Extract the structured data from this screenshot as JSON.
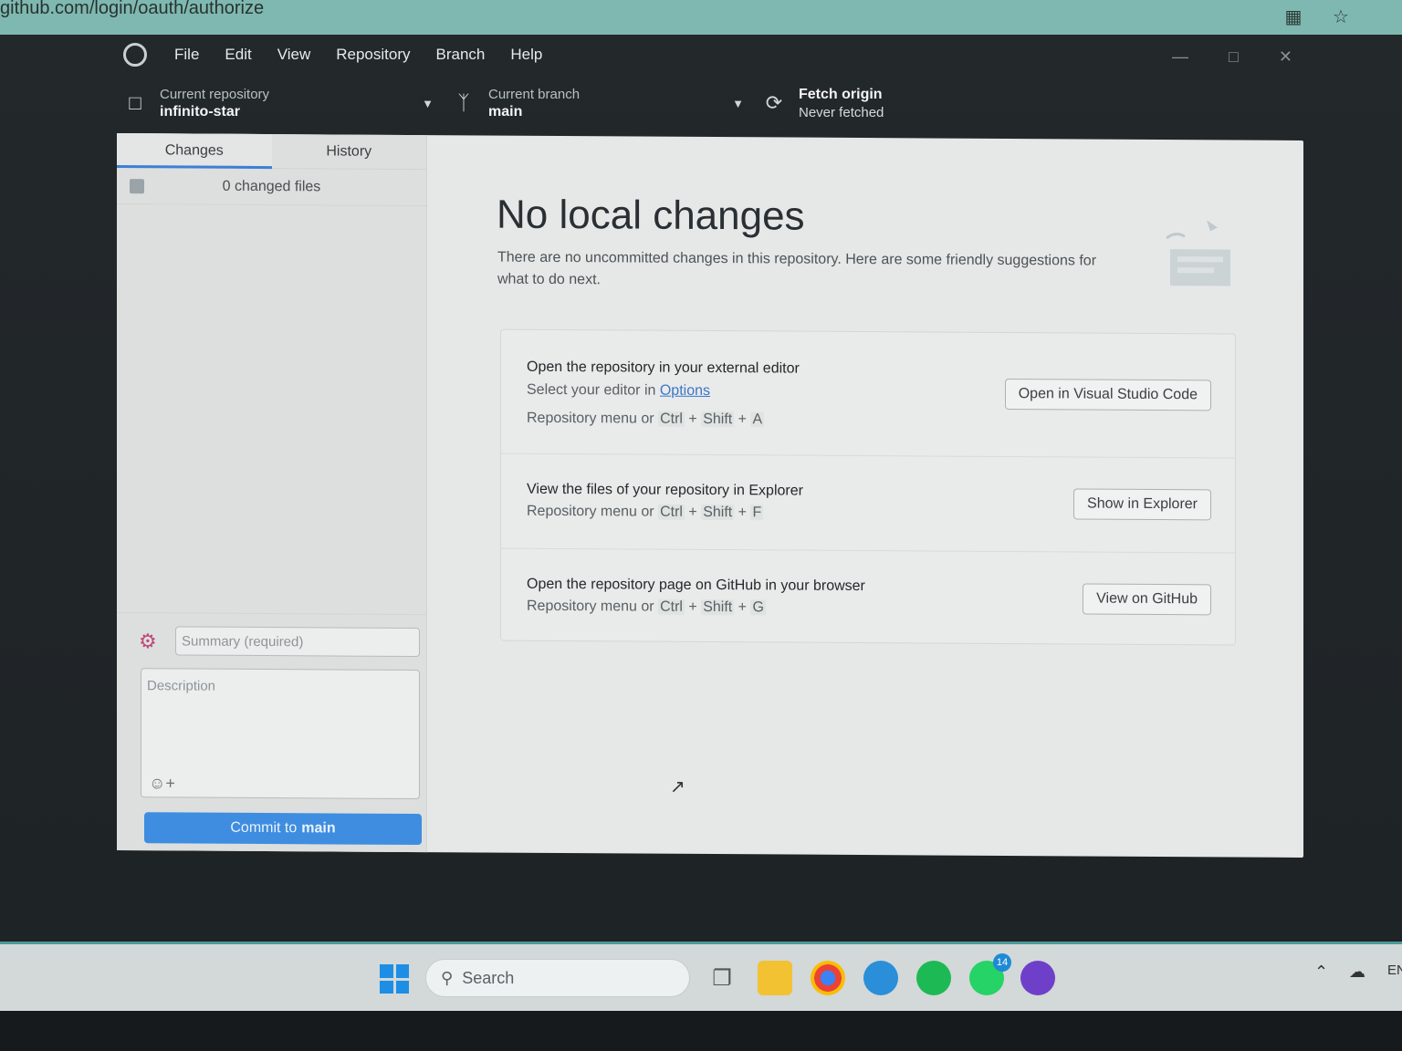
{
  "browser": {
    "url": "github.com/login/oauth/authorize"
  },
  "menu": {
    "items": [
      "File",
      "Edit",
      "View",
      "Repository",
      "Branch",
      "Help"
    ]
  },
  "toolbar": {
    "repo_label": "Current repository",
    "repo_value": "infinito-star",
    "branch_label": "Current branch",
    "branch_value": "main",
    "fetch_label": "Fetch origin",
    "fetch_status": "Never fetched"
  },
  "sidebar": {
    "tabs": [
      "Changes",
      "History"
    ],
    "changed_files": "0 changed files",
    "summary_placeholder": "Summary (required)",
    "description_placeholder": "Description",
    "commit_prefix": "Commit to",
    "commit_branch": "main"
  },
  "main": {
    "title": "No local changes",
    "subtitle": "There are no uncommitted changes in this repository. Here are some friendly suggestions for what to do next.",
    "suggestions": [
      {
        "title": "Open the repository in your external editor",
        "line1_prefix": "Select your editor in",
        "line1_link": "Options",
        "shortcut_prefix": "Repository menu or",
        "keys": [
          "Ctrl",
          "Shift",
          "A"
        ],
        "button": "Open in Visual Studio Code"
      },
      {
        "title": "View the files of your repository in Explorer",
        "shortcut_prefix": "Repository menu or",
        "keys": [
          "Ctrl",
          "Shift",
          "F"
        ],
        "button": "Show in Explorer"
      },
      {
        "title": "Open the repository page on GitHub in your browser",
        "shortcut_prefix": "Repository menu or",
        "keys": [
          "Ctrl",
          "Shift",
          "G"
        ],
        "button": "View on GitHub"
      }
    ]
  },
  "taskbar": {
    "search_label": "Search",
    "whatsapp_badge": "14",
    "tray_lang": "EN"
  },
  "colors": {
    "accent": "#3e8de0",
    "link": "#3d76c7",
    "taskbar_border": "#4c9a96"
  }
}
